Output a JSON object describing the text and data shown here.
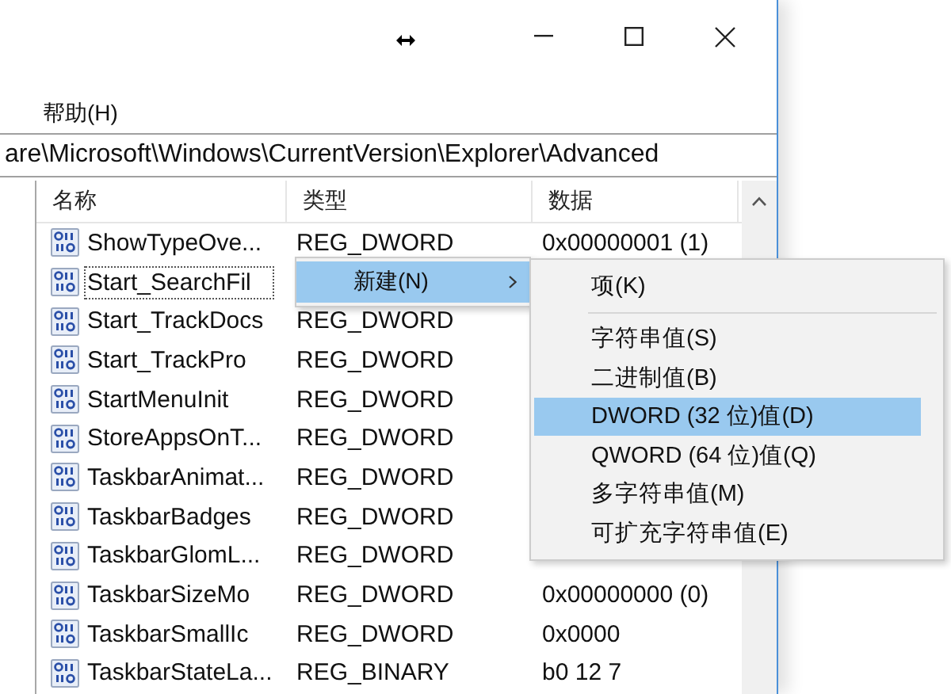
{
  "menu_bar": [
    {
      "label": "帮助(H)"
    }
  ],
  "address": "are\\Microsoft\\Windows\\CurrentVersion\\Explorer\\Advanced",
  "list": {
    "columns": [
      "名称",
      "类型",
      "数据"
    ],
    "rows": [
      {
        "name": "ShowTypeOve...",
        "type": "REG_DWORD",
        "data": "0x00000001 (1)",
        "selected": false
      },
      {
        "name": "Start_SearchFil",
        "selected": true
      },
      {
        "name": "Start_TrackDocs",
        "type": "REG_DWORD",
        "selected": false
      },
      {
        "name": "Start_TrackPro",
        "type": "REG_DWORD",
        "selected": false
      },
      {
        "name": "StartMenuInit",
        "type": "REG_DWORD",
        "selected": false
      },
      {
        "name": "StoreAppsOnT...",
        "type": "REG_DWORD",
        "selected": false
      },
      {
        "name": "TaskbarAnimat...",
        "type": "REG_DWORD",
        "selected": false
      },
      {
        "name": "TaskbarBadges",
        "type": "REG_DWORD",
        "selected": false
      },
      {
        "name": "TaskbarGlomL...",
        "type": "REG_DWORD",
        "selected": false
      },
      {
        "name": "TaskbarSizeMo",
        "type": "REG_DWORD",
        "data": "0x00000000 (0)",
        "selected": false
      },
      {
        "name": "TaskbarSmallIc",
        "type": "REG_DWORD",
        "data": "0x0000",
        "selected": false
      },
      {
        "name": "TaskbarStateLa...",
        "type": "REG_BINARY",
        "data": "b0 12 7",
        "selected": false
      }
    ]
  },
  "context_menu": [
    {
      "label": "新建(N)",
      "selected": true
    }
  ],
  "submenu": [
    {
      "kind": "item",
      "label": "项(K)",
      "selected": false
    },
    {
      "kind": "separator"
    },
    {
      "kind": "item",
      "label": "字符串值(S)",
      "selected": false
    },
    {
      "kind": "item",
      "label": "二进制值(B)",
      "selected": false
    },
    {
      "kind": "item",
      "label": "DWORD (32 位)值(D)",
      "selected": true
    },
    {
      "kind": "item",
      "label": "QWORD (64 位)值(Q)",
      "selected": false
    },
    {
      "kind": "item",
      "label": "多字符串值(M)",
      "selected": false
    },
    {
      "kind": "item",
      "label": "可扩充字符串值(E)",
      "selected": false
    }
  ]
}
